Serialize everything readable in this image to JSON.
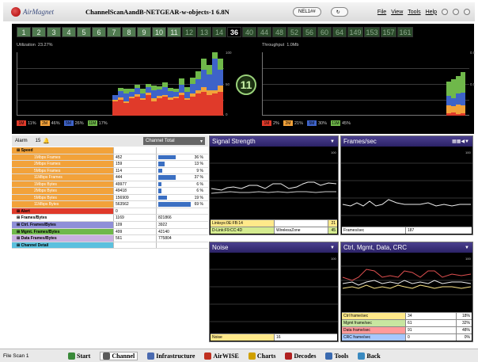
{
  "app": {
    "logo_text": "AirMagnet",
    "title": "ChannelScanAandB-NETGEAR-w-objects-1 6.8N",
    "pill1": "NEL1##",
    "menus": [
      "File",
      "View",
      "Tools",
      "Help"
    ]
  },
  "channels": {
    "group1": [
      "1",
      "2",
      "3",
      "4",
      "5",
      "6",
      "7",
      "8",
      "9",
      "10",
      "11"
    ],
    "group2": [
      "12",
      "13",
      "14"
    ],
    "current": "36",
    "group3": [
      "40",
      "44",
      "48",
      "52",
      "56",
      "60",
      "64",
      "149",
      "153",
      "157",
      "161"
    ],
    "selected": "11"
  },
  "utilization": {
    "label": "Utilization",
    "value": "23.27%",
    "legend": [
      {
        "tag": "1M",
        "color": "#e03a2a",
        "pct": "11%"
      },
      {
        "tag": "2M",
        "color": "#f2a23a",
        "pct": "46%"
      },
      {
        "tag": "5M",
        "color": "#3e63c9",
        "pct": "26%"
      },
      {
        "tag": "11M",
        "color": "#6fb84a",
        "pct": "17%"
      }
    ],
    "axis": [
      "100",
      "50",
      "0"
    ]
  },
  "throughput": {
    "label": "Throughput",
    "value": "1.0Mb",
    "legend": [
      {
        "tag": "1M",
        "color": "#e03a2a",
        "pct": "2%"
      },
      {
        "tag": "2M",
        "color": "#f2a23a",
        "pct": "21%"
      },
      {
        "tag": "5M",
        "color": "#3e63c9",
        "pct": "30%"
      },
      {
        "tag": "11M",
        "color": "#6fb84a",
        "pct": "45%"
      }
    ],
    "axis": [
      "0.9",
      "0.5",
      "0"
    ]
  },
  "alarm": {
    "label": "Alarm",
    "count": "15",
    "channel_total": "Channel Total"
  },
  "stats": [
    {
      "label": "Speed",
      "value": "",
      "pct": "",
      "bar": 0,
      "color": "#f2a23a",
      "kind": "hdr"
    },
    {
      "label": "1Mbps Frames",
      "value": "452",
      "pct": "36 %",
      "bar": 0.36,
      "color": "#f2a23a",
      "kind": "sub"
    },
    {
      "label": "2Mbps Frames",
      "value": "159",
      "pct": "13 %",
      "bar": 0.13,
      "color": "#f2a23a",
      "kind": "sub"
    },
    {
      "label": "5Mbps Frames",
      "value": "114",
      "pct": "9 %",
      "bar": 0.09,
      "color": "#f2a23a",
      "kind": "sub"
    },
    {
      "label": "11Mbps Frames",
      "value": "444",
      "pct": "37 %",
      "bar": 0.37,
      "color": "#f2a23a",
      "kind": "sub"
    },
    {
      "label": "1Mbps Bytes",
      "value": "49977",
      "pct": "6 %",
      "bar": 0.06,
      "color": "#f2a23a",
      "kind": "sub"
    },
    {
      "label": "2Mbps Bytes",
      "value": "49418",
      "pct": "6 %",
      "bar": 0.06,
      "color": "#f2a23a",
      "kind": "sub"
    },
    {
      "label": "5Mbps Bytes",
      "value": "156909",
      "pct": "19 %",
      "bar": 0.19,
      "color": "#f2a23a",
      "kind": "sub"
    },
    {
      "label": "11Mbps Bytes",
      "value": "563562",
      "pct": "69 %",
      "bar": 0.69,
      "color": "#f2a23a",
      "kind": "sub"
    },
    {
      "label": "Alert",
      "value": "0",
      "pct": "",
      "bar": 0,
      "color": "#e03a2a",
      "kind": "hdr"
    },
    {
      "label": "Frames/Bytes",
      "value": "1169",
      "pct": "821866",
      "bar": 0,
      "color": "#ffffff",
      "kind": "hdr"
    },
    {
      "label": "Ctrl. Frames/Bytes",
      "value": "109",
      "pct": "3922",
      "bar": 0,
      "color": "#8f8fd8",
      "kind": "hdr"
    },
    {
      "label": "Mgmt. Frames/Bytes",
      "value": "499",
      "pct": "42140",
      "bar": 0,
      "color": "#6fb84a",
      "kind": "hdr"
    },
    {
      "label": "Data Frames/Bytes",
      "value": "561",
      "pct": "775804",
      "bar": 0,
      "color": "#c8b0e0",
      "kind": "hdr"
    },
    {
      "label": "Channel Detail",
      "value": "",
      "pct": "",
      "bar": 0,
      "color": "#5bc0de",
      "kind": "hdr"
    }
  ],
  "panes": {
    "signal": {
      "title": "Signal Strength",
      "rows": [
        {
          "l": "Linksys:0E:FB:14",
          "m": "",
          "r": "21",
          "bg": "#ffe98a"
        },
        {
          "l": "D-Link:F9:CC:4D",
          "m": "WirelessZone",
          "r": "45",
          "bg": "#d4eb8f"
        }
      ]
    },
    "frames": {
      "title": "Frames/sec",
      "rows": [
        {
          "l": "Frames/sec",
          "m": "187",
          "r": "",
          "bg": "#ffffff"
        }
      ]
    },
    "noise": {
      "title": "Noise",
      "rows": [
        {
          "l": "Noise",
          "m": "16",
          "r": "",
          "bg": "#ffe98a"
        }
      ]
    },
    "ctrl": {
      "title": "Ctrl, Mgmt, Data, CRC",
      "rows": [
        {
          "l": "Ctrl frame/sec",
          "m": "34",
          "r": "18%",
          "bg": "#ffe98a"
        },
        {
          "l": "Mgmt frame/sec",
          "m": "61",
          "r": "32%",
          "bg": "#c8e6a0"
        },
        {
          "l": "Data frame/sec",
          "m": "91",
          "r": "48%",
          "bg": "#ff9a9a"
        },
        {
          "l": "CRC frame/sec",
          "m": "0",
          "r": "0%",
          "bg": "#a6c8ff"
        }
      ]
    }
  },
  "statusbar": {
    "file": "File Scan 1",
    "tabs": [
      {
        "label": "Start",
        "color": "#3a8a3a"
      },
      {
        "label": "Channel",
        "color": "#5a5a5a"
      },
      {
        "label": "Infrastructure",
        "color": "#4a6ab0"
      },
      {
        "label": "AirWISE",
        "color": "#c03020"
      },
      {
        "label": "Charts",
        "color": "#d0a000"
      },
      {
        "label": "Decodes",
        "color": "#b02020"
      },
      {
        "label": "Tools",
        "color": "#3a6ab0"
      },
      {
        "label": "Back",
        "color": "#3a8ac0"
      }
    ]
  }
}
